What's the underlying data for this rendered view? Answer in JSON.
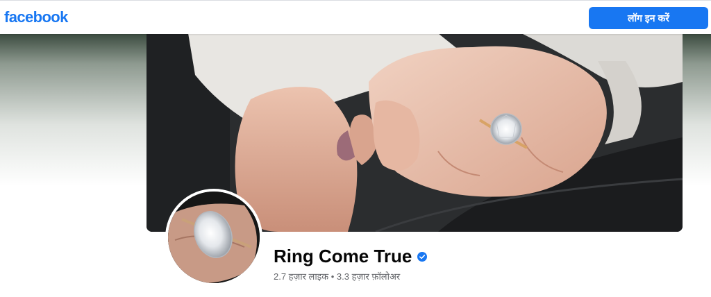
{
  "header": {
    "logo_text": "facebook",
    "login_label": "लॉग इन करें"
  },
  "profile": {
    "name": "Ring Come True",
    "verified": true,
    "likes": "2.7 हज़ार लाइक",
    "separator": "•",
    "followers": "3.3 हज़ार फ़ॉलोअर"
  },
  "colors": {
    "brand": "#1877f2",
    "name_text": "#050505",
    "secondary_text": "#65676b"
  },
  "icons": {
    "verified": "verified-badge-icon"
  }
}
